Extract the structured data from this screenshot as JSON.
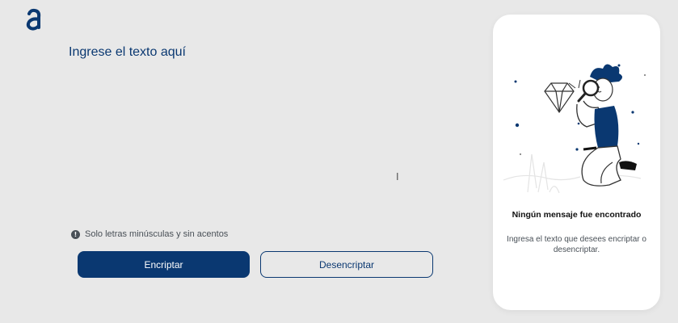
{
  "logo": {
    "icon": "alura-logo-icon",
    "color": "#0a3871"
  },
  "editor": {
    "placeholder": "Ingrese el texto aquí",
    "value": ""
  },
  "cursor": {
    "glyph": "I"
  },
  "hint": {
    "icon": "info-icon",
    "text": "Solo letras minúsculas y sin acentos"
  },
  "buttons": {
    "encrypt": "Encriptar",
    "decrypt": "Desencriptar"
  },
  "output_panel": {
    "illustration": "person-with-magnifying-glass-icon",
    "title": "Ningún mensaje fue encontrado",
    "message": "Ingresa el texto que desees encriptar o desencriptar."
  },
  "colors": {
    "background": "#e8e8e8",
    "accent": "#0a3871",
    "panel": "#ffffff",
    "muted_text": "#495057"
  }
}
